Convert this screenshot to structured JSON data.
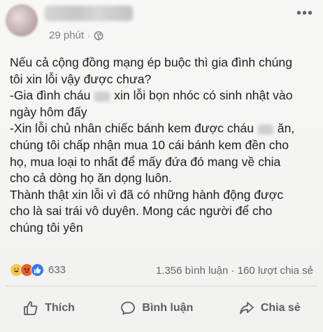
{
  "post": {
    "time": "29 phút",
    "separator": "·",
    "icons": {
      "privacy": "globe-icon",
      "more": "more-options-icon"
    },
    "lines": [
      "Nếu cả cộng đồng mạng ép buộc thì gia đình chúng",
      "tôi xin lỗi vậy được chưa?",
      "-Gia đình cháu",
      "xin lỗi bọn nhóc có sinh nhật vào",
      "ngày hôm đấy",
      "-Xin lỗi chủ nhân chiếc bánh kem được cháu",
      "ăn,",
      "chúng tôi chấp nhận mua 10 cái bánh kem đền cho",
      "họ, mua loại to nhất để mấy đứa đó mang về chia",
      "cho cả dòng họ ăn dọng luôn.",
      "Thành thật xin lỗi vì đã có những hành động được",
      "cho là sai trái vô duyên. Mong các người để cho",
      "chúng tôi yên"
    ]
  },
  "reactions": {
    "types": [
      "haha-icon",
      "angry-icon",
      "like-icon"
    ],
    "count": "633"
  },
  "stats": {
    "comments": "1.356 bình luận",
    "dot": "·",
    "shares": "160 lượt chia sẻ"
  },
  "actions": {
    "like": "Thích",
    "comment": "Bình luận",
    "share": "Chia sẻ"
  }
}
